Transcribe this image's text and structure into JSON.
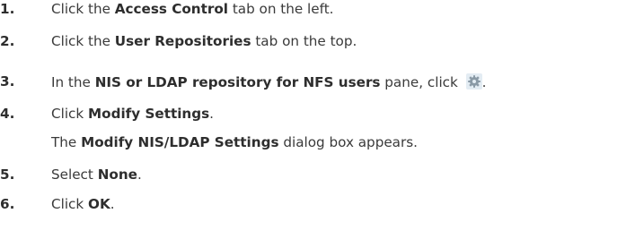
{
  "steps": [
    {
      "number": "1.",
      "pre": "Click the ",
      "bold": "Access Control",
      "post": " tab on the left."
    },
    {
      "number": "2.",
      "pre": "Click the ",
      "bold": "User Repositories",
      "post": " tab on the top."
    },
    {
      "number": "3.",
      "pre": "In the ",
      "bold": "NIS or LDAP repository for NFS users",
      "mid": " pane, click ",
      "icon": "gear-icon",
      "post": "."
    },
    {
      "number": "4.",
      "pre": "Click ",
      "bold": "Modify Settings",
      "post": ".",
      "result_pre": "The ",
      "result_bold": "Modify NIS/LDAP Settings",
      "result_post": " dialog box appears."
    },
    {
      "number": "5.",
      "pre": "Select ",
      "bold": "None",
      "post": "."
    },
    {
      "number": "6.",
      "pre": "Click ",
      "bold": "OK",
      "post": "."
    }
  ],
  "colors": {
    "text": "#3a3a3a",
    "bold_text": "#2e2e2e",
    "icon_bg": "#e3ecf3",
    "icon_gear": "#8a9aa6"
  }
}
